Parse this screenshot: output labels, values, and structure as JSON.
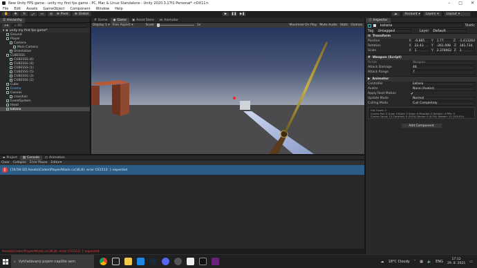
{
  "window": {
    "title": "New Unity FPS game - unity my first fps game - PC, Mac & Linux Standalone - Unity 2020.3.17f1 Personal* <DX11>"
  },
  "menu": [
    "File",
    "Edit",
    "Assets",
    "GameObject",
    "Component",
    "Window",
    "Help"
  ],
  "toolbar": {
    "left_buttons": [
      "Pivot",
      "Global"
    ],
    "account": "Account",
    "layers": "Layers",
    "layout": "Layout"
  },
  "hierarchy": {
    "tab": "Hierarchy",
    "search_placeholder": "All",
    "scene": "unity my first fps game*",
    "items": [
      {
        "label": "Ground",
        "indent": 1
      },
      {
        "label": "Player",
        "indent": 1
      },
      {
        "label": "Camera",
        "indent": 2
      },
      {
        "label": "Main Camera",
        "indent": 3
      },
      {
        "label": "Orientation",
        "indent": 2
      },
      {
        "label": "CUBESSS",
        "indent": 1
      },
      {
        "label": "CUBESSS (6)",
        "indent": 2
      },
      {
        "label": "CUBESSS (4)",
        "indent": 2
      },
      {
        "label": "CUBESSS (1)",
        "indent": 2
      },
      {
        "label": "CUBESSS (5)",
        "indent": 2
      },
      {
        "label": "CUBESSS (3)",
        "indent": 2
      },
      {
        "label": "CUBESSS (2)",
        "indent": 2
      },
      {
        "label": "Cube",
        "indent": 1
      },
      {
        "label": "Enemy",
        "indent": 1
      },
      {
        "label": "Canvas",
        "indent": 1
      },
      {
        "label": "crosshair",
        "indent": 2
      },
      {
        "label": "EventSystem",
        "indent": 1
      },
      {
        "label": "Head",
        "indent": 1
      },
      {
        "label": "katana",
        "indent": 1
      }
    ]
  },
  "game_view": {
    "tabs": [
      "Scene",
      "Game",
      "Asset Store",
      "Animator"
    ],
    "display": "Display 1",
    "aspect": "Free Aspect",
    "scale_label": "Scale",
    "scale_value": "1x",
    "toggles": [
      "Maximize On Play",
      "Mute Audio",
      "Stats",
      "Gizmos"
    ]
  },
  "inspector": {
    "tab": "Inspector",
    "object_name": "katana",
    "static_label": "Static",
    "tag_label": "Tag",
    "tag_value": "Untagged",
    "layer_label": "Layer",
    "layer_value": "Default",
    "transform": {
      "title": "Transform",
      "position": {
        "label": "Position",
        "x": "-0.885",
        "y": "1.77",
        "z": "-1.413264"
      },
      "rotation": {
        "label": "Rotation",
        "x": "22.43",
        "y": "-261.098",
        "z": "181.734"
      },
      "scale": {
        "label": "Scale",
        "x": "1",
        "y": "2.378002",
        "z": "1"
      }
    },
    "weapon": {
      "title": "Weapon (Script)",
      "script_label": "Script",
      "script_value": "Weapon",
      "damage_label": "Attack Damage",
      "damage_value": "48",
      "range_label": "Attack Range",
      "range_value": "7"
    },
    "animator": {
      "title": "Animator",
      "controller_label": "Controller",
      "controller_value": "katana",
      "avatar_label": "Avatar",
      "avatar_value": "None (Avatar)",
      "root_motion_label": "Apply Root Motion",
      "update_mode_label": "Update Mode",
      "update_mode_value": "Normal",
      "culling_label": "Culling Mode",
      "culling_value": "Cull Completely",
      "info": "Clip Count: 2\nCurves Pos: 0 Quat: 0 Euler: 2 Scale: 0 Muscles: 0 Generic: 0 PPtr: 0\nCurves Count: 12 Constant: 0 (0.0%) Dense: 0 (0.0%) Stream: 12 (100.0%)"
    },
    "add_component": "Add Component"
  },
  "console": {
    "tabs": [
      "Project",
      "Console",
      "Animation"
    ],
    "toolbar": [
      "Clear",
      "Collapse",
      "Error Pause",
      "Editor"
    ],
    "error_text": "[16:59:32] Assets\\Codes\\PlayerAttack.cs(36,8): error CS1513: } expected",
    "status_error": "Assets\\Codes\\PlayerAttack.cs(36,8): error CS1513: } expected"
  },
  "taskbar": {
    "search_placeholder": "Vyhľadávaný pojem napíšte sem",
    "weather": "18°C  Cloudy",
    "lang": "ENG",
    "time": "17:12",
    "date": "29. 8. 2021"
  },
  "colors": {
    "accent_blue": "#2c5d87",
    "error_red": "#e04040",
    "sky_top": "#2b3b66",
    "sky_bottom": "#8d96a8",
    "ground": "#4d4d4f"
  }
}
